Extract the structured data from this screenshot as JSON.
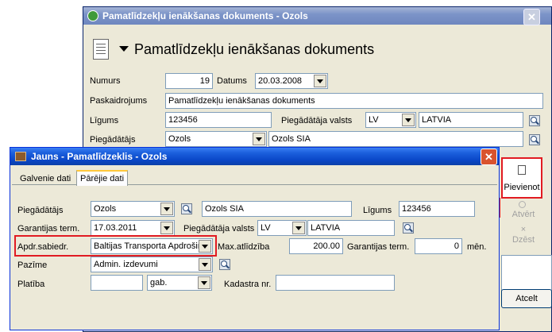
{
  "back_window": {
    "title": "Pamatlīdzekļu ienākšanas dokuments - Ozols",
    "close_glyph": "✕",
    "header_title": "Pamatlīdzekļu ienākšanas dokuments",
    "fields": {
      "numurs_label": "Numurs",
      "numurs_value": "19",
      "datums_label": "Datums",
      "datums_value": "20.03.2008",
      "paskaidrojums_label": "Paskaidrojums",
      "paskaidrojums_value": "Pamatlīdzekļu ienākšanas dokuments",
      "ligums_label": "Līgums",
      "ligums_value": "123456",
      "valsts_label": "Piegādātāja valsts",
      "valsts_code": "LV",
      "valsts_name": "LATVIA",
      "piegadatajs_label": "Piegādātājs",
      "piegadatajs_code": "Ozols",
      "piegadatajs_name": "Ozols SIA"
    },
    "side_buttons": {
      "pievienot": "Pievienot",
      "atvert": "Atvērt",
      "dzest": "Dzēst",
      "atcelt": "Atcelt"
    }
  },
  "front_window": {
    "title": "Jauns - Pamatlīdzeklis - Ozols",
    "close_glyph": "✕",
    "tabs": [
      "Galvenie dati",
      "Pārējie dati"
    ],
    "fields": {
      "piegadatajs_label": "Piegādātājs",
      "piegadatajs_code": "Ozols",
      "piegadatajs_name": "Ozols SIA",
      "ligums_label": "Līgums",
      "ligums_value": "123456",
      "garantijas_label": "Garantijas term.",
      "garantijas_value": "17.03.2011",
      "valsts_label": "Piegādātāja valsts",
      "valsts_code": "LV",
      "valsts_name": "LATVIA",
      "apdr_label": "Apdr.sabiedr.",
      "apdr_value": "Baltijas Transporta Apdrošin",
      "max_label": "Max.atlīdzība",
      "max_value": "200.00",
      "garantijas2_label": "Garantijas term.",
      "garantijas2_value": "0",
      "men_label": "mēn.",
      "pazime_label": "Pazīme",
      "pazime_value": "Admin. izdevumi",
      "platiba_label": "Platība",
      "platiba_value": "",
      "unit_value": "gab.",
      "kadastra_label": "Kadastra nr.",
      "kadastra_value": ""
    }
  },
  "colors": {
    "highlight_red": "#e11b22",
    "title_active": "#0a47c8",
    "title_inactive": "#7c94c8",
    "window_face": "#ece9d8"
  }
}
